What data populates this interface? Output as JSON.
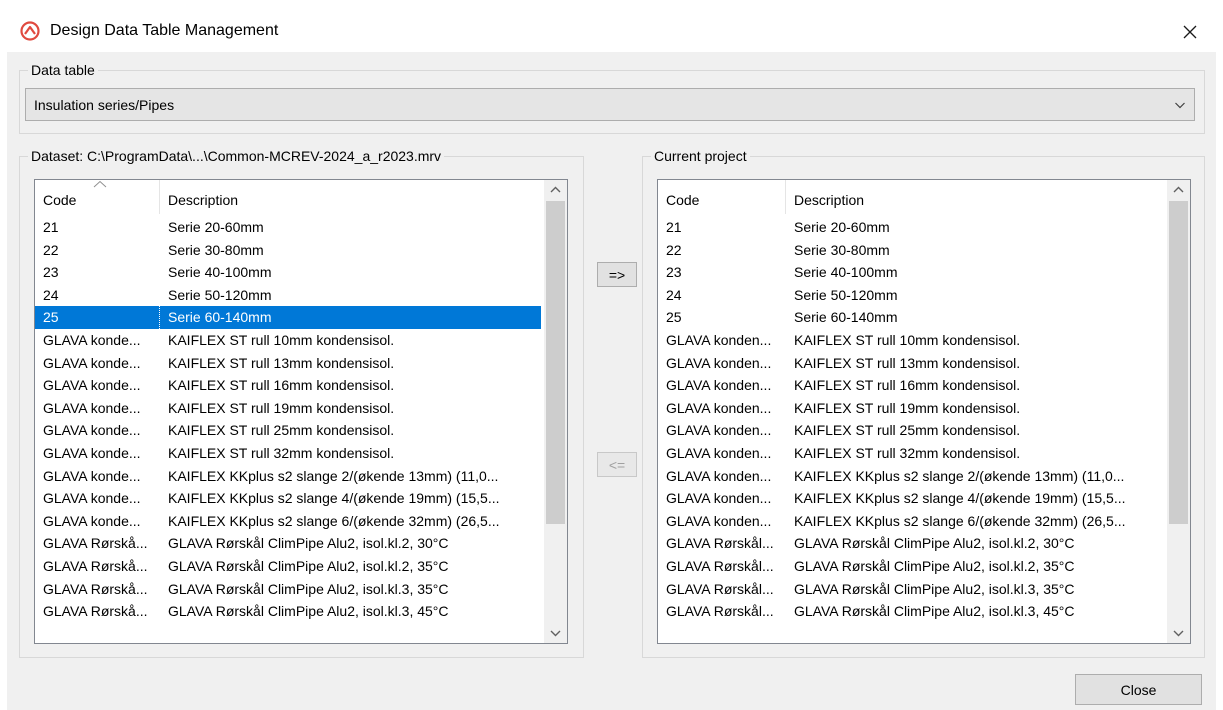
{
  "window": {
    "title": "Design Data Table Management",
    "accent_color": "#e04a3f"
  },
  "data_table": {
    "label": "Data table",
    "selected": "Insulation series/Pipes"
  },
  "dataset": {
    "label": "Dataset: C:\\ProgramData\\...\\Common-MCREV-2024_a_r2023.mrv",
    "columns": [
      "Code",
      "Description"
    ],
    "selected_index": 4,
    "rows": [
      {
        "code": "21",
        "description": "Serie 20-60mm"
      },
      {
        "code": "22",
        "description": "Serie 30-80mm"
      },
      {
        "code": "23",
        "description": "Serie 40-100mm"
      },
      {
        "code": "24",
        "description": "Serie 50-120mm"
      },
      {
        "code": "25",
        "description": "Serie 60-140mm"
      },
      {
        "code": "GLAVA konde...",
        "description": "KAIFLEX ST rull 10mm kondensisol."
      },
      {
        "code": "GLAVA konde...",
        "description": "KAIFLEX ST rull 13mm kondensisol."
      },
      {
        "code": "GLAVA konde...",
        "description": "KAIFLEX ST rull 16mm kondensisol."
      },
      {
        "code": "GLAVA konde...",
        "description": "KAIFLEX ST rull 19mm kondensisol."
      },
      {
        "code": "GLAVA konde...",
        "description": "KAIFLEX ST rull 25mm kondensisol."
      },
      {
        "code": "GLAVA konde...",
        "description": "KAIFLEX ST rull 32mm kondensisol."
      },
      {
        "code": "GLAVA konde...",
        "description": "KAIFLEX KKplus s2 slange 2/(økende 13mm) (11,0..."
      },
      {
        "code": "GLAVA konde...",
        "description": "KAIFLEX KKplus s2 slange 4/(økende 19mm) (15,5..."
      },
      {
        "code": "GLAVA konde...",
        "description": "KAIFLEX KKplus s2 slange 6/(økende 32mm) (26,5..."
      },
      {
        "code": "GLAVA Rørskå...",
        "description": "GLAVA Rørskål ClimPipe Alu2, isol.kl.2, 30°C"
      },
      {
        "code": "GLAVA Rørskå...",
        "description": "GLAVA Rørskål ClimPipe Alu2, isol.kl.2, 35°C"
      },
      {
        "code": "GLAVA Rørskå...",
        "description": "GLAVA Rørskål ClimPipe Alu2, isol.kl.3, 35°C"
      },
      {
        "code": "GLAVA Rørskå...",
        "description": "GLAVA Rørskål ClimPipe Alu2, isol.kl.3, 45°C"
      }
    ]
  },
  "current_project": {
    "label": "Current project",
    "columns": [
      "Code",
      "Description"
    ],
    "rows": [
      {
        "code": "21",
        "description": "Serie 20-60mm"
      },
      {
        "code": "22",
        "description": "Serie 30-80mm"
      },
      {
        "code": "23",
        "description": "Serie 40-100mm"
      },
      {
        "code": "24",
        "description": "Serie 50-120mm"
      },
      {
        "code": "25",
        "description": "Serie 60-140mm"
      },
      {
        "code": "GLAVA konden...",
        "description": "KAIFLEX ST rull 10mm kondensisol."
      },
      {
        "code": "GLAVA konden...",
        "description": "KAIFLEX ST rull 13mm kondensisol."
      },
      {
        "code": "GLAVA konden...",
        "description": "KAIFLEX ST rull 16mm kondensisol."
      },
      {
        "code": "GLAVA konden...",
        "description": "KAIFLEX ST rull 19mm kondensisol."
      },
      {
        "code": "GLAVA konden...",
        "description": "KAIFLEX ST rull 25mm kondensisol."
      },
      {
        "code": "GLAVA konden...",
        "description": "KAIFLEX ST rull 32mm kondensisol."
      },
      {
        "code": "GLAVA konden...",
        "description": "KAIFLEX KKplus s2 slange 2/(økende 13mm) (11,0..."
      },
      {
        "code": "GLAVA konden...",
        "description": "KAIFLEX KKplus s2 slange 4/(økende 19mm) (15,5..."
      },
      {
        "code": "GLAVA konden...",
        "description": "KAIFLEX KKplus s2 slange 6/(økende 32mm) (26,5..."
      },
      {
        "code": "GLAVA Rørskål...",
        "description": "GLAVA Rørskål ClimPipe Alu2, isol.kl.2, 30°C"
      },
      {
        "code": "GLAVA Rørskål...",
        "description": "GLAVA Rørskål ClimPipe Alu2, isol.kl.2, 35°C"
      },
      {
        "code": "GLAVA Rørskål...",
        "description": "GLAVA Rørskål ClimPipe Alu2, isol.kl.3, 35°C"
      },
      {
        "code": "GLAVA Rørskål...",
        "description": "GLAVA Rørskål ClimPipe Alu2, isol.kl.3, 45°C"
      }
    ]
  },
  "buttons": {
    "copy_right": "=>",
    "copy_left": "<=",
    "close": "Close"
  },
  "colors": {
    "selection": "#0078d7",
    "scroll_thumb": "#cdcdcd"
  },
  "icons": {
    "app": "app-logo-icon",
    "close": "close-icon",
    "dropdown": "chevron-down-icon",
    "sort": "sort-ascending-icon",
    "scroll_up": "scroll-up-arrow-icon",
    "scroll_down": "scroll-down-arrow-icon"
  }
}
